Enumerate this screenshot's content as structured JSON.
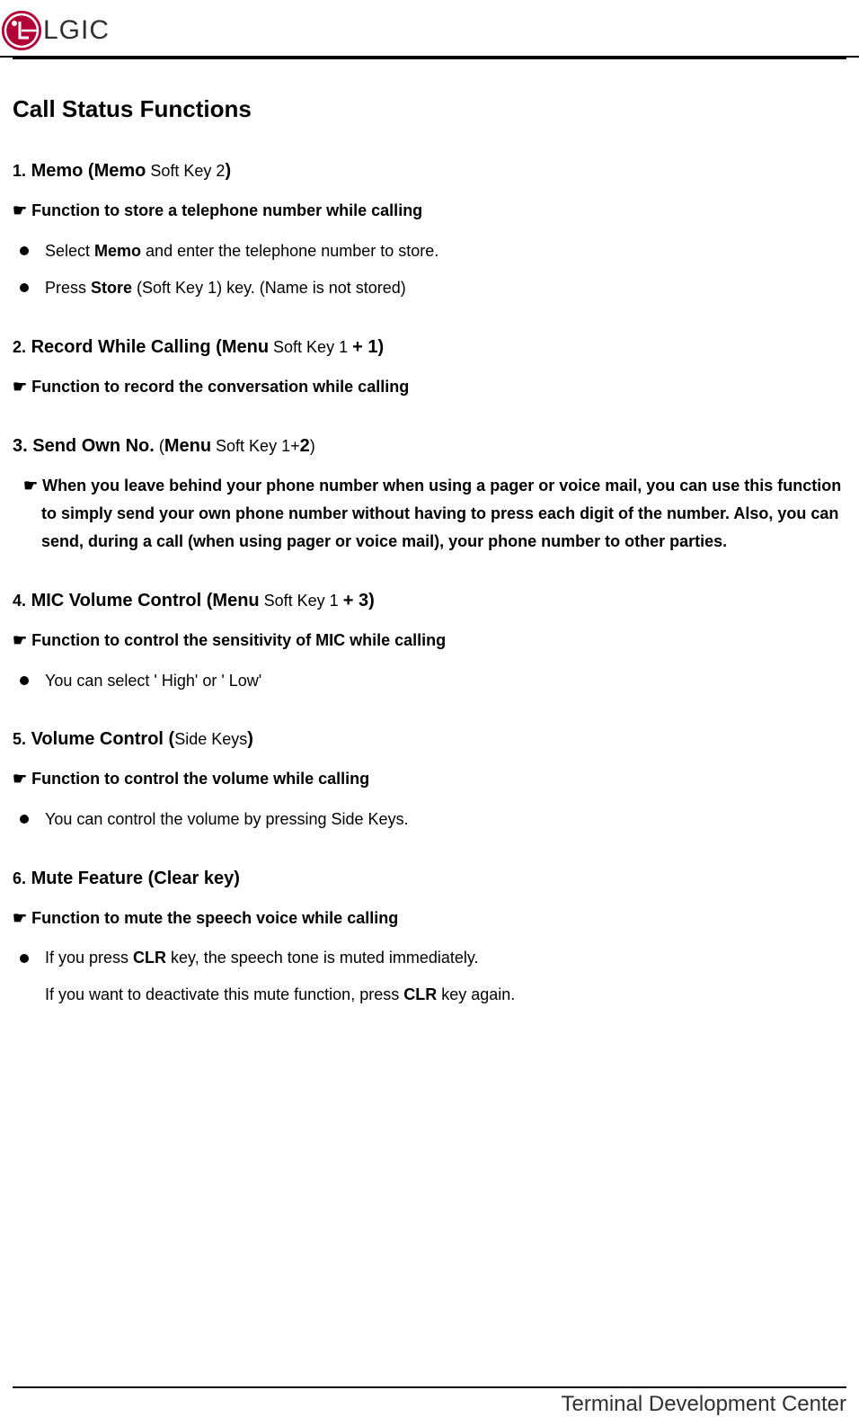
{
  "header": {
    "logo_text": "LGIC"
  },
  "main_title": "Call Status Functions",
  "sections": [
    {
      "num": "1.",
      "title_bold": "Memo (Memo",
      "title_light": " Soft Key 2",
      "title_end": ")",
      "subtitle": "☛ Function to store a telephone number while calling",
      "bullets": [
        {
          "prefix": "Select ",
          "bold": "Memo",
          "suffix": " and enter the telephone number to store."
        },
        {
          "prefix": "Press ",
          "bold": "Store",
          "suffix": " (Soft Key 1) key. (Name is not stored)"
        }
      ]
    },
    {
      "num": "2.",
      "title_bold": "Record While Calling (Menu",
      "title_light": " Soft Key 1 ",
      "title_end": "+ 1)",
      "subtitle": "☛ Function to record the conversation while calling"
    },
    {
      "num": "3.",
      "title_bold_full": "Send Own No.",
      "title_paren_light": " (",
      "title_paren_bold": "Menu",
      "title_paren_light2": " Soft Key 1+",
      "title_paren_bold2": "2",
      "title_paren_end": ")",
      "subtitle_multi": "☛ When you leave behind your phone number when using a pager or voice mail, you can use this function to simply send your own phone number without having to press each digit of the number. Also, you can send, during a call (when using pager or voice mail), your phone number to other parties."
    },
    {
      "num": "4.",
      "title_bold": "MIC Volume Control (Menu",
      "title_light": " Soft Key 1 ",
      "title_end": "+ 3)",
      "subtitle": "☛ Function to control the sensitivity of MIC while calling",
      "bullets_plain": [
        "You can select ' High'  or ' Low'"
      ]
    },
    {
      "num": "5.",
      "title_bold": "Volume Control (",
      "title_light": "Side Keys",
      "title_end": ")",
      "subtitle": "☛ Function to control the volume while calling",
      "bullets_plain": [
        "You can control the volume by pressing Side Keys."
      ]
    },
    {
      "num": "6.",
      "title_bold": "Mute Feature (Clear key)",
      "subtitle": "☛ Function to mute the speech voice while calling",
      "bullets": [
        {
          "prefix": "If you press ",
          "bold": "CLR",
          "suffix": " key, the speech tone is muted immediately."
        }
      ],
      "continue_line": {
        "prefix": "If you want to deactivate this mute function, press ",
        "bold": "CLR",
        "suffix": " key again."
      }
    }
  ],
  "footer": {
    "text": "Terminal Development Center"
  }
}
